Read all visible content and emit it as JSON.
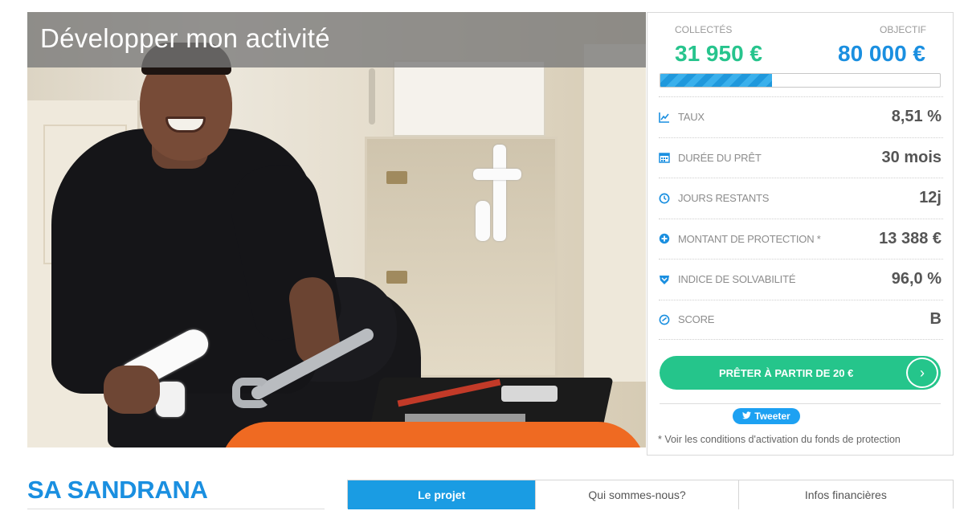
{
  "hero": {
    "title": "Développer mon activité"
  },
  "funding": {
    "collected_label": "COLLECTÉS",
    "collected_value": "31 950 €",
    "goal_label": "OBJECTIF",
    "goal_value": "80 000 €",
    "progress_fraction": 0.4
  },
  "stats": [
    {
      "icon": "line-chart-icon",
      "label": "TAUX",
      "value": "8,51 %"
    },
    {
      "icon": "calendar-icon",
      "label": "DURÉE DU PRÊT",
      "value": "30 mois"
    },
    {
      "icon": "clock-icon",
      "label": "JOURS RESTANTS",
      "value": "12j"
    },
    {
      "icon": "shield-plus-icon",
      "label": "MONTANT DE PROTECTION *",
      "value": "13 388 €"
    },
    {
      "icon": "badge-icon",
      "label": "INDICE DE SOLVABILITÉ",
      "value": "96,0 %"
    },
    {
      "icon": "gauge-icon",
      "label": "SCORE",
      "value": "B"
    }
  ],
  "cta": {
    "lend_label": "PRÊTER À PARTIR DE 20 €",
    "arrow_glyph": "›",
    "tweet_label": "Tweeter",
    "footnote": "* Voir les conditions d'activation du fonds de protection"
  },
  "company": {
    "name": "SA SANDRANA"
  },
  "tabs": [
    {
      "label": "Le projet",
      "active": true
    },
    {
      "label": "Qui sommes-nous?",
      "active": false
    },
    {
      "label": "Infos financières",
      "active": false
    }
  ],
  "colors": {
    "green": "#25c58b",
    "blue": "#1a8fe0",
    "tab_active": "#1a9ce3",
    "twitter": "#1da1f2"
  }
}
